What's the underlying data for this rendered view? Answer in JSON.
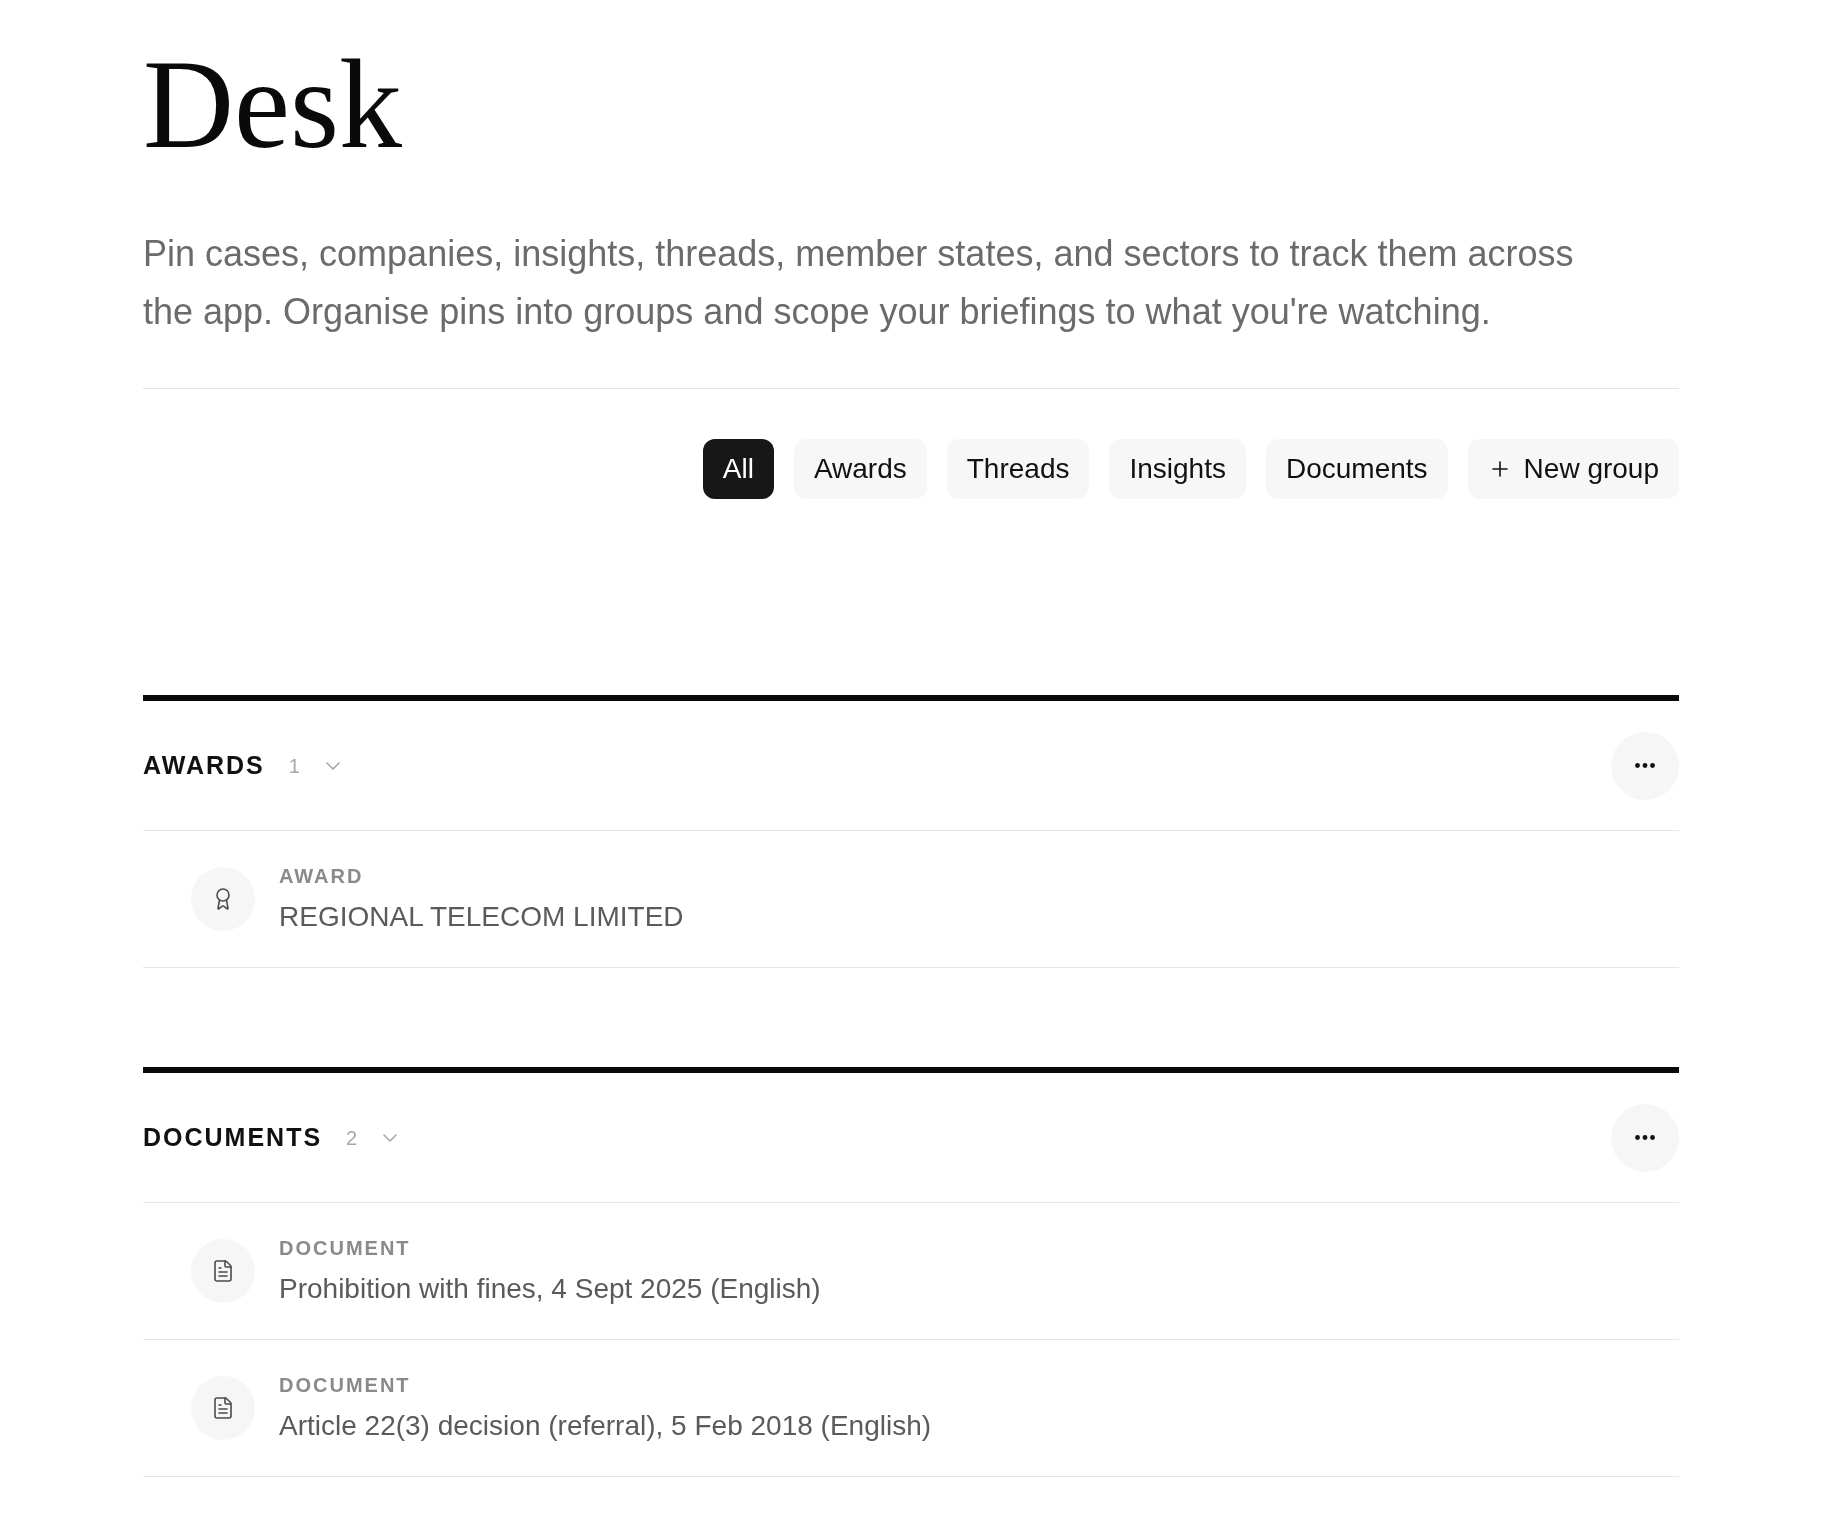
{
  "page": {
    "title": "Desk",
    "description": "Pin cases, companies, insights, threads, member states, and sectors to track them across the app. Organise pins into groups and scope your briefings to what you're watching."
  },
  "filters": [
    {
      "label": "All",
      "selected": true
    },
    {
      "label": "Awards",
      "selected": false
    },
    {
      "label": "Threads",
      "selected": false
    },
    {
      "label": "Insights",
      "selected": false
    },
    {
      "label": "Documents",
      "selected": false
    }
  ],
  "new_group_button": {
    "label": "New group"
  },
  "groups": [
    {
      "title": "AWARDS",
      "count": "1",
      "expanded": true,
      "items": [
        {
          "kind": "award",
          "type_label": "AWARD",
          "name": "REGIONAL TELECOM LIMITED"
        }
      ]
    },
    {
      "title": "DOCUMENTS",
      "count": "2",
      "expanded": true,
      "items": [
        {
          "kind": "document",
          "type_label": "DOCUMENT",
          "name": "Prohibition with fines, 4 Sept 2025 (English)"
        },
        {
          "kind": "document",
          "type_label": "DOCUMENT",
          "name": "Article 22(3) decision (referral), 5 Feb 2018 (English)"
        }
      ]
    }
  ]
}
